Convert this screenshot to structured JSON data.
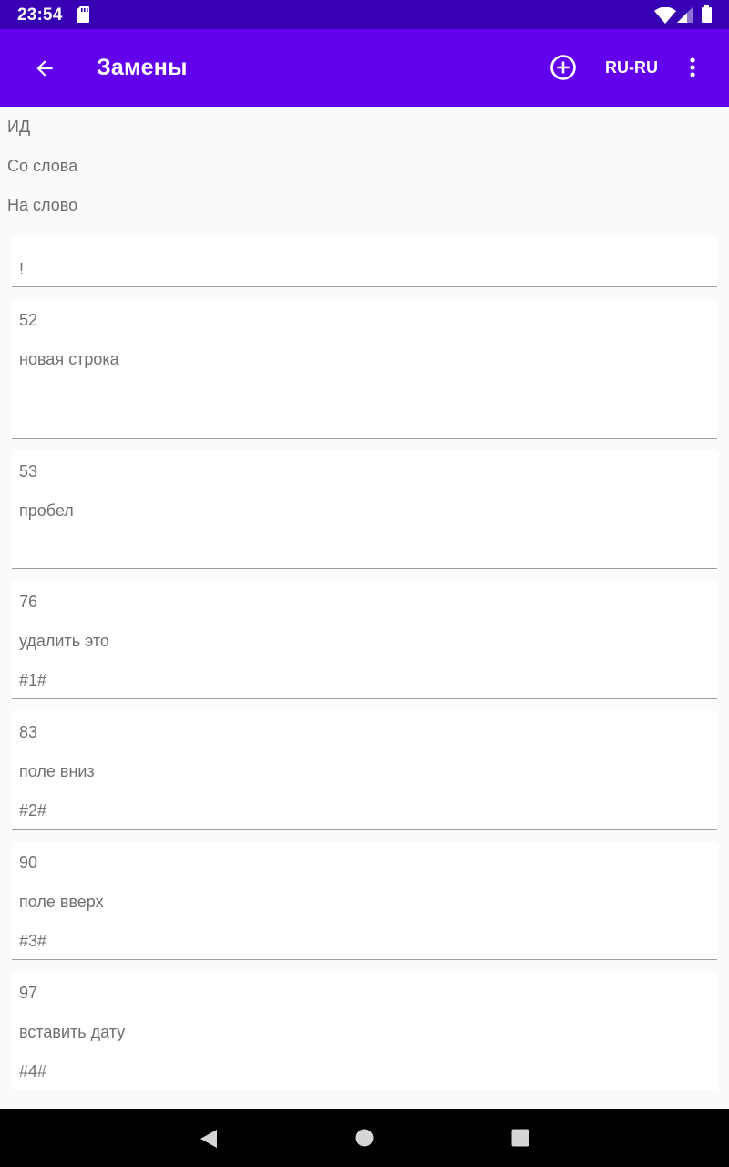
{
  "status_bar": {
    "time": "23:54",
    "icons": [
      "sd-card-icon",
      "wifi-icon",
      "signal-icon",
      "battery-icon"
    ]
  },
  "app_bar": {
    "title": "Замены",
    "back_icon": "arrow-back-icon",
    "add_icon": "add-circle-icon",
    "language": "RU-RU",
    "more_icon": "more-vert-icon",
    "color": "#6200ee",
    "status_color": "#3700b3"
  },
  "header": {
    "id_label": "ИД",
    "from_label": "Со слова",
    "to_label": "На слово"
  },
  "rows": [
    {
      "id": "",
      "from": "",
      "to": "!"
    },
    {
      "id": "52",
      "from": "новая строка",
      "to": ""
    },
    {
      "id": "53",
      "from": "пробел",
      "to": ""
    },
    {
      "id": "76",
      "from": "удалить это",
      "to": "#1#"
    },
    {
      "id": "83",
      "from": "поле вниз",
      "to": "#2#"
    },
    {
      "id": "90",
      "from": "поле вверх",
      "to": "#3#"
    },
    {
      "id": "97",
      "from": "вставить дату",
      "to": "#4#"
    }
  ],
  "nav_bar": {
    "icons": [
      "nav-back-icon",
      "nav-home-icon",
      "nav-recents-icon"
    ]
  }
}
